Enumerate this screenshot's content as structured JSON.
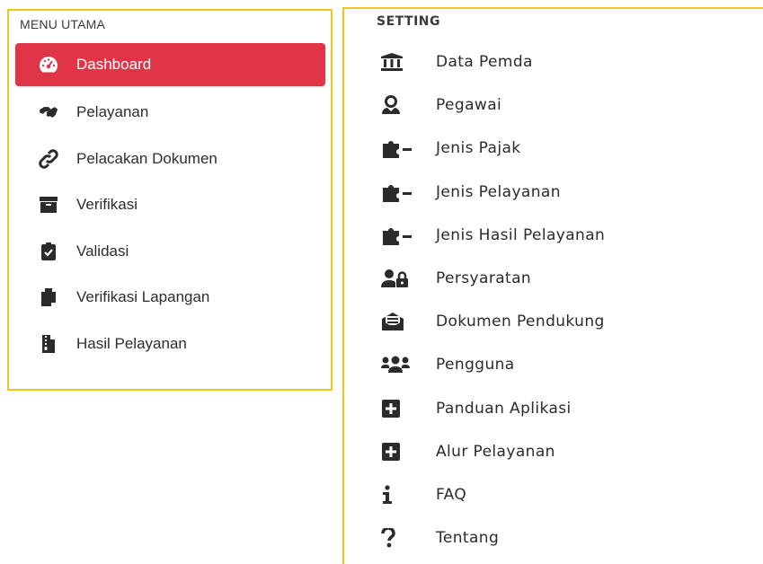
{
  "menu_utama": {
    "title": "MENU UTAMA",
    "items": [
      {
        "label": "Dashboard",
        "icon": "tachometer-icon",
        "active": true
      },
      {
        "label": "Pelayanan",
        "icon": "handshake-icon"
      },
      {
        "label": "Pelacakan Dokumen",
        "icon": "link-icon"
      },
      {
        "label": "Verifikasi",
        "icon": "archive-icon"
      },
      {
        "label": "Validasi",
        "icon": "clipboard-check-icon"
      },
      {
        "label": "Verifikasi Lapangan",
        "icon": "copy-icon"
      },
      {
        "label": "Hasil Pelayanan",
        "icon": "file-archive-icon"
      }
    ]
  },
  "setting": {
    "title": "SETTING",
    "items": [
      {
        "label": "Data Pemda",
        "icon": "landmark-icon"
      },
      {
        "label": "Pegawai",
        "icon": "user-tie-icon"
      },
      {
        "label": "Jenis Pajak",
        "icon": "puzzle-icon"
      },
      {
        "label": "Jenis Pelayanan",
        "icon": "puzzle-icon"
      },
      {
        "label": "Jenis Hasil Pelayanan",
        "icon": "puzzle-icon"
      },
      {
        "label": "Persyaratan",
        "icon": "user-lock-icon"
      },
      {
        "label": "Dokumen Pendukung",
        "icon": "envelope-open-text-icon"
      },
      {
        "label": "Pengguna",
        "icon": "users-icon"
      },
      {
        "label": "Panduan Aplikasi",
        "icon": "plus-square-icon"
      },
      {
        "label": "Alur Pelayanan",
        "icon": "plus-square-icon"
      },
      {
        "label": "FAQ",
        "icon": "info-icon"
      },
      {
        "label": "Tentang",
        "icon": "question-icon"
      }
    ]
  },
  "colors": {
    "active_bg": "#e03547",
    "border": "#f4c21c",
    "icon": "#2b2b2b"
  }
}
